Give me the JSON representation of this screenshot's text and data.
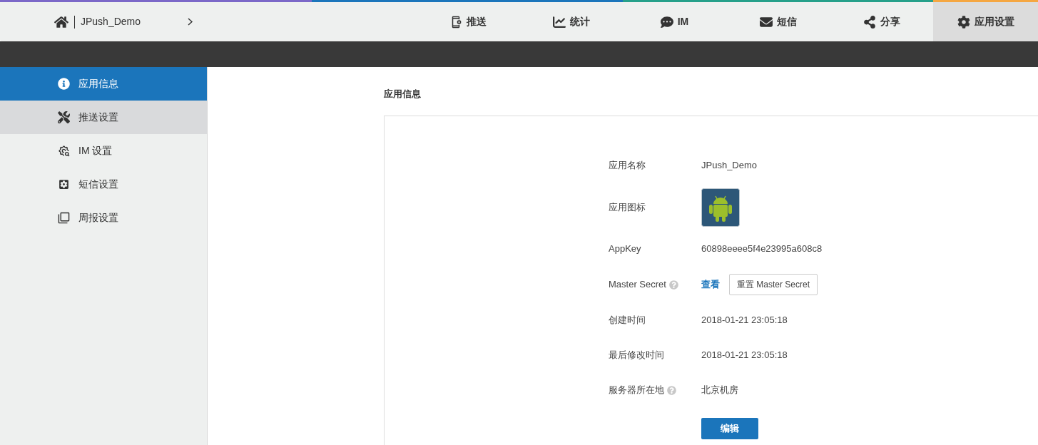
{
  "breadcrumb": {
    "app_name": "JPush_Demo"
  },
  "nav": [
    {
      "label": "推送",
      "selected": false
    },
    {
      "label": "统计",
      "selected": false
    },
    {
      "label": "IM",
      "selected": false
    },
    {
      "label": "短信",
      "selected": false
    },
    {
      "label": "分享",
      "selected": false
    },
    {
      "label": "应用设置",
      "selected": true
    }
  ],
  "sidebar": {
    "items": [
      {
        "label": "应用信息",
        "selected": true,
        "hovered": false
      },
      {
        "label": "推送设置",
        "selected": false,
        "hovered": true
      },
      {
        "label": "IM 设置",
        "selected": false,
        "hovered": false
      },
      {
        "label": "短信设置",
        "selected": false,
        "hovered": false
      },
      {
        "label": "周报设置",
        "selected": false,
        "hovered": false
      }
    ]
  },
  "section_title": "应用信息",
  "fields": [
    {
      "kind": "text",
      "label": "应用名称",
      "help": false,
      "value": "JPush_Demo"
    },
    {
      "kind": "image",
      "label": "应用图标",
      "help": false
    },
    {
      "kind": "text",
      "label": "AppKey",
      "help": false,
      "value": "60898eeee5f4e23995a608c8"
    },
    {
      "kind": "secret",
      "label": "Master Secret",
      "help": true,
      "link": "查看",
      "button": "重置 Master Secret"
    },
    {
      "kind": "text",
      "label": "创建时间",
      "help": false,
      "value": "2018-01-21 23:05:18"
    },
    {
      "kind": "text",
      "label": "最后修改时间",
      "help": false,
      "value": "2018-01-21 23:05:18"
    },
    {
      "kind": "text",
      "label": "服务器所在地",
      "help": true,
      "value": "北京机房"
    }
  ],
  "edit_button": "编辑"
}
